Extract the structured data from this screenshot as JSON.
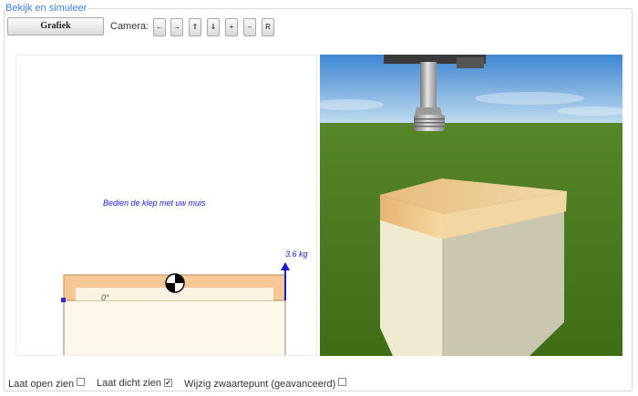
{
  "legend": "Bekijk en simuleer",
  "toolbar": {
    "grafiek_label": "Grafiek",
    "camera_label": "Camera:",
    "camera_buttons": [
      {
        "name": "camera-left-button",
        "glyph": "←"
      },
      {
        "name": "camera-right-button",
        "glyph": "→"
      },
      {
        "name": "camera-up-button",
        "glyph": "⇑"
      },
      {
        "name": "camera-down-button",
        "glyph": "⇓"
      },
      {
        "name": "camera-zoom-in-button",
        "glyph": "+"
      },
      {
        "name": "camera-zoom-out-button",
        "glyph": "–"
      },
      {
        "name": "camera-reset-button",
        "glyph": "R"
      }
    ]
  },
  "sketch": {
    "hint": "Bedien de klep met uw muis",
    "weight": "3.6 kg",
    "angle": "0°",
    "colors": {
      "lid": "#f6c896",
      "body": "#fdf8ea",
      "arrow": "#1a1ad0",
      "hinge": "#2a2ad8"
    }
  },
  "scene": {
    "colors": {
      "sky_top": "#4a8ed6",
      "sky_bottom": "#b7d8ee",
      "grass": "#4d7d1c",
      "lid": "#e3b776",
      "box_front": "#efe9cc",
      "box_side": "#c9c4ad"
    }
  },
  "options": {
    "open_label": "Laat open zien",
    "open_checked": false,
    "closed_label": "Laat dicht zien",
    "closed_checked": true,
    "cog_label": "Wijzig zwaartepunt (geavanceerd)",
    "cog_checked": false
  }
}
